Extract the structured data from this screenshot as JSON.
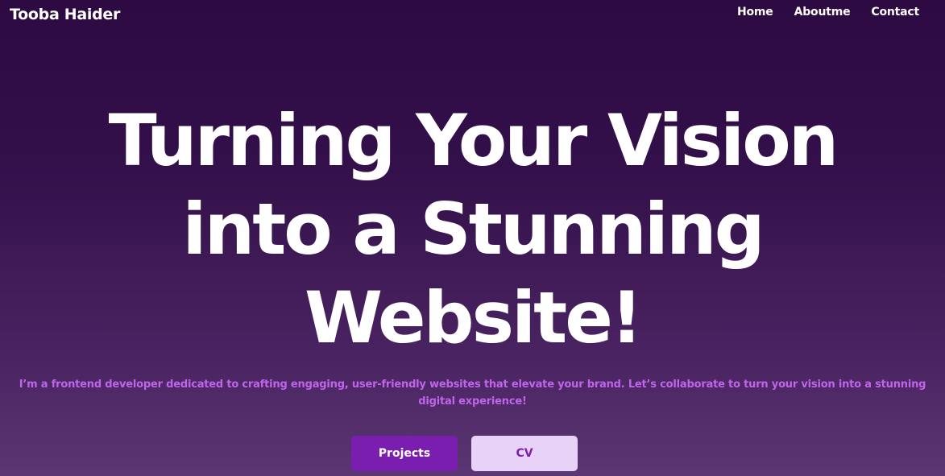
{
  "header": {
    "brand": "Tooba Haider",
    "nav": [
      "Home",
      "Aboutme",
      "Contact"
    ]
  },
  "hero": {
    "headline_lines": [
      "Turning Your Vision",
      "into a Stunning",
      "Website!"
    ],
    "subtitle": "I’m a frontend developer dedicated to crafting engaging, user-friendly websites that elevate your brand. Let’s collaborate to turn your vision into a stunning digital experience!",
    "buttons": {
      "projects": "Projects",
      "cv": "CV"
    }
  },
  "colors": {
    "background_top": "#2d0a42",
    "background_bottom": "#5a3672",
    "accent": "#c064ec",
    "primary_button": "#7a1eaf",
    "secondary_button": "#e8d2f7"
  }
}
